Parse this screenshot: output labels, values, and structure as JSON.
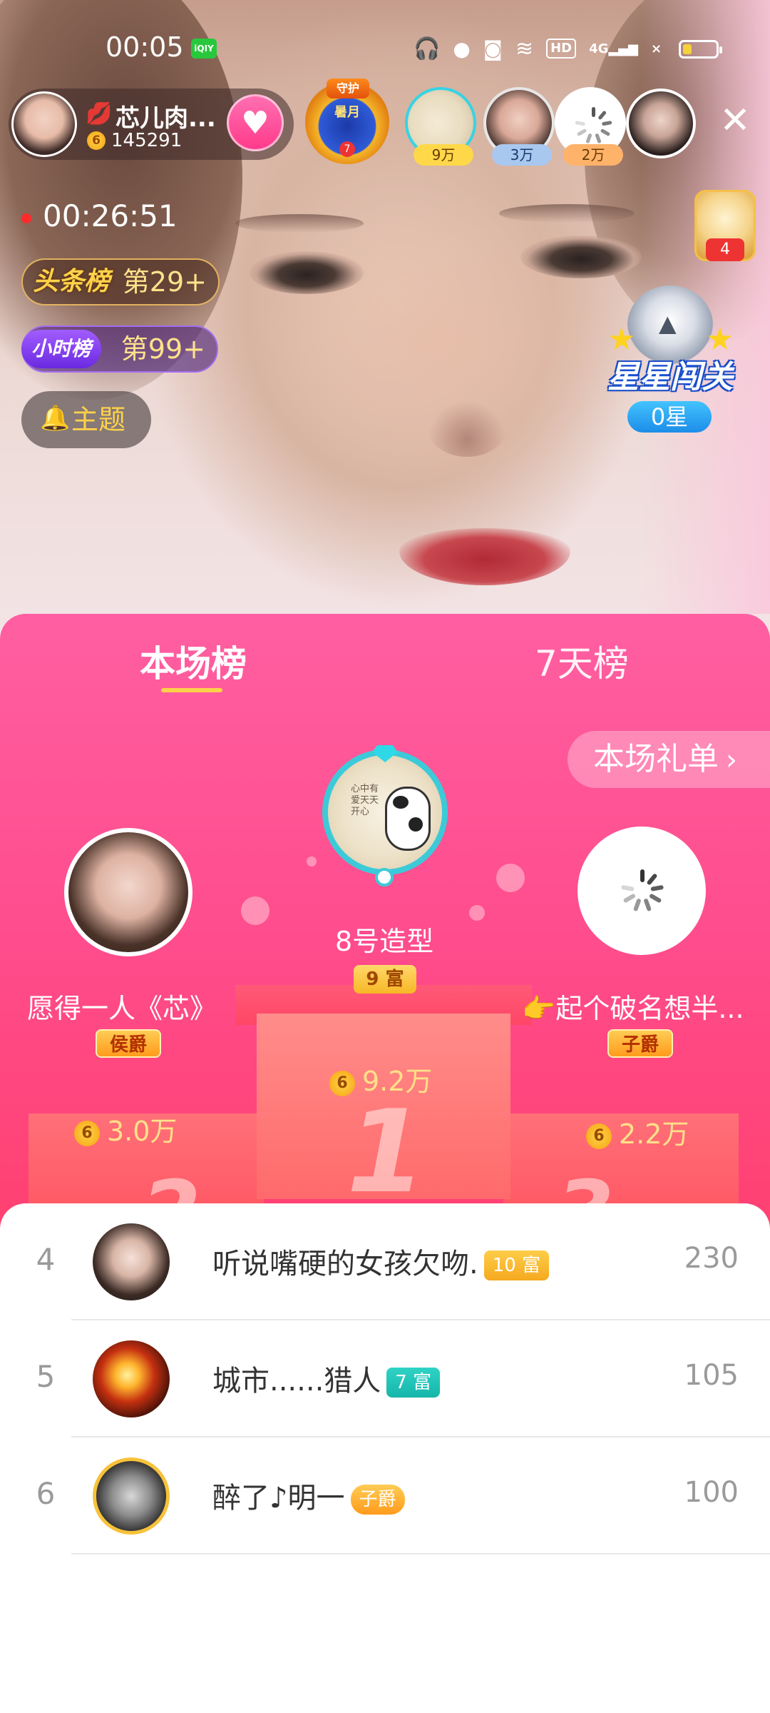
{
  "status_bar": {
    "time": "00:05",
    "app_icon": "iqiyi-icon",
    "icons": [
      "headphones-icon",
      "microphone-icon",
      "camera-icon",
      "wifi-icon",
      "hd-icon",
      "4g-signal-icon",
      "no-signal-icon",
      "battery-icon"
    ],
    "hd_label": "HD",
    "network_label": "4G"
  },
  "host": {
    "name": "芯儿肉...",
    "fans_count": "145291",
    "coin_label": "6",
    "follow_icon": "heart-icon"
  },
  "guard_badge": {
    "top_text": "守护",
    "main_text": "暑月",
    "count": "7"
  },
  "viewers": [
    {
      "tag": "9万",
      "tag_color": "#ffd84a"
    },
    {
      "tag": "3万",
      "tag_color": "#a8c8f0"
    },
    {
      "tag": "2万",
      "tag_color": "#ffb26a"
    },
    {
      "tag": ""
    }
  ],
  "live": {
    "duration": "00:26:51"
  },
  "rank_pills": {
    "headline": {
      "label": "头条榜",
      "value": "第29+"
    },
    "hourly": {
      "label": "小时榜",
      "value": "第99+"
    }
  },
  "topic": {
    "label": "主题"
  },
  "chest": {
    "count": "4"
  },
  "star_gate": {
    "title": "星星闯关",
    "count": "0星"
  },
  "ranking": {
    "tabs": [
      "本场榜",
      "7天榜"
    ],
    "active_tab": 0,
    "gift_list_label": "本场礼单",
    "podium": {
      "first": {
        "name": "8号造型",
        "badge": "9 富",
        "score": "9.2万",
        "avatar_scribble": "心中有爱天天开心"
      },
      "second": {
        "name": "愿得一人《芯》",
        "badge": "侯爵",
        "score": "3.0万"
      },
      "third": {
        "name": "👉起个破名想半...",
        "badge": "子爵",
        "score": "2.2万"
      },
      "numbers": [
        "1",
        "2",
        "3"
      ]
    },
    "list": [
      {
        "rank": "4",
        "name": "听说嘴硬的女孩欠吻.",
        "badge": "10 富",
        "badge_style": "yellow",
        "points": "230"
      },
      {
        "rank": "5",
        "name": "城市......猎人",
        "badge": "7 富",
        "badge_style": "teal",
        "points": "105"
      },
      {
        "rank": "6",
        "name": "醉了♪明一",
        "badge": "子爵",
        "badge_style": "title",
        "points": "100"
      }
    ]
  },
  "colors": {
    "sheet_top": "#ff5fa2",
    "sheet_bottom": "#ff4b5f",
    "accent_gold": "#ffd24a",
    "tab_underline": "#ffd24a"
  }
}
